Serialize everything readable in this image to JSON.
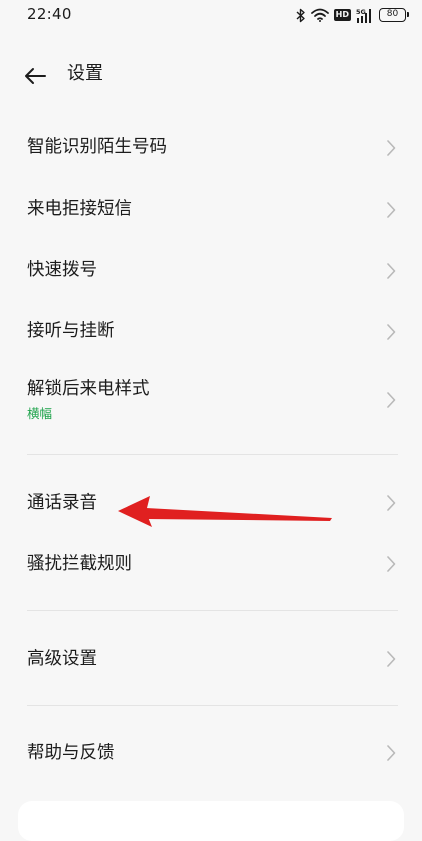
{
  "status_bar": {
    "time": "22:40",
    "hd_label": "HD",
    "battery_level": "80",
    "network_label": "5G",
    "icons": [
      "bluetooth-icon",
      "wifi-icon",
      "hd-icon",
      "signal-icon",
      "battery-icon"
    ]
  },
  "header": {
    "title": "设置",
    "back_icon": "back-arrow-icon"
  },
  "settings": {
    "items": [
      {
        "label": "智能识别陌生号码"
      },
      {
        "label": "来电拒接短信"
      },
      {
        "label": "快速拨号"
      },
      {
        "label": "接听与挂断"
      },
      {
        "label": "解锁后来电样式",
        "sub": "横幅"
      },
      {
        "label": "通话录音"
      },
      {
        "label": "骚扰拦截规则"
      },
      {
        "label": "高级设置"
      },
      {
        "label": "帮助与反馈"
      }
    ]
  },
  "annotation": {
    "color": "#e02020",
    "target": "通话录音"
  },
  "colors": {
    "background": "#f7f7f7",
    "text": "#1c1c1c",
    "subtext_green": "#1ea34b",
    "chevron": "#b9b9b9",
    "divider": "#e4e4e4"
  }
}
